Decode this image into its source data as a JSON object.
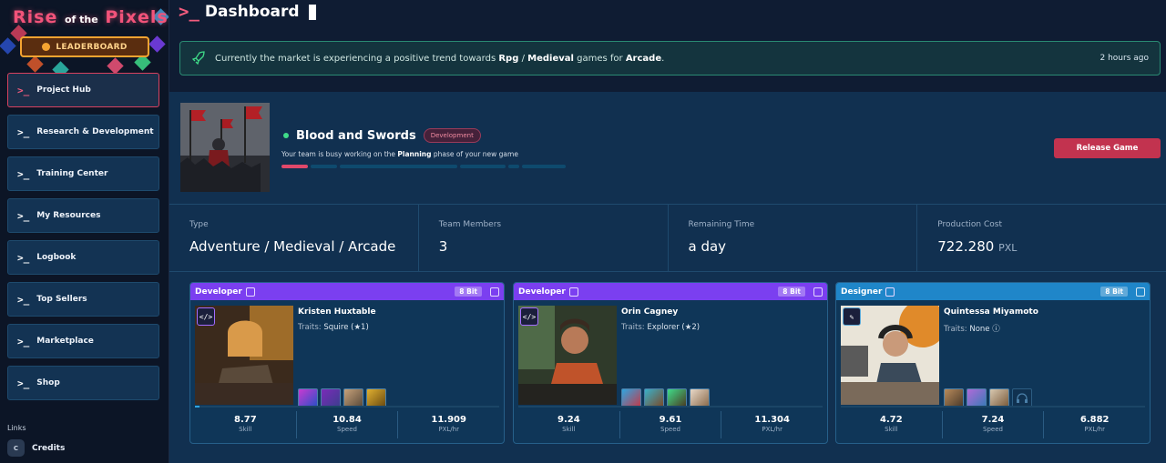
{
  "brand": {
    "title_a": "Rise",
    "title_b": "of the",
    "title_c": "Pixels",
    "leaderboard_label": "LEADERBOARD"
  },
  "nav": {
    "prompt": ">_",
    "items": [
      {
        "label": "Project Hub",
        "active": true
      },
      {
        "label": "Research & Development"
      },
      {
        "label": "Training Center"
      },
      {
        "label": "My Resources"
      },
      {
        "label": "Logbook"
      },
      {
        "label": "Top Sellers"
      },
      {
        "label": "Marketplace"
      },
      {
        "label": "Shop"
      }
    ],
    "links_heading": "Links",
    "credits_key": "C",
    "credits_label": "Credits"
  },
  "header": {
    "prompt": ">_",
    "title": "Dashboard"
  },
  "notice": {
    "text_1": "Currently the market is experiencing a positive trend towards",
    "genre_1": "Rpg",
    "sep": "/",
    "genre_2": "Medieval",
    "text_2": "games for",
    "platform": "Arcade",
    "dot": ".",
    "time": "2 hours ago"
  },
  "game": {
    "name": "Blood and Swords",
    "status": "Development",
    "sub_1": "Your team is busy working on the",
    "phase": "Planning",
    "sub_2": "phase of your new game",
    "release_label": "Release Game",
    "progress_segments": 6,
    "progress_done": 1
  },
  "stats": [
    {
      "label": "Type",
      "value": "Adventure / Medieval / Arcade",
      "unit": ""
    },
    {
      "label": "Team Members",
      "value": "3",
      "unit": ""
    },
    {
      "label": "Remaining Time",
      "value": "a day",
      "unit": ""
    },
    {
      "label": "Production Cost",
      "value": "722.280",
      "unit": "PXL"
    }
  ],
  "colors": {
    "developer": "#7b3ff0",
    "designer": "#1f86c9",
    "accent": "#f25c7d",
    "notice_border": "#2a8a72"
  },
  "members": [
    {
      "role": "Developer",
      "tier": "8 Bit",
      "badge": "</>",
      "name": "Kristen Huxtable",
      "traits_label": "Traits:",
      "traits": "Squire (★1)",
      "skill": "8.77",
      "speed": "10.84",
      "pxl": "11.909",
      "skill_label": "Skill",
      "speed_label": "Speed",
      "pxl_label": "PXL/hr",
      "progress": 0.015
    },
    {
      "role": "Developer",
      "tier": "8 Bit",
      "badge": "</>",
      "name": "Orin Cagney",
      "traits_label": "Traits:",
      "traits": "Explorer (★2)",
      "skill": "9.24",
      "speed": "9.61",
      "pxl": "11.304",
      "skill_label": "Skill",
      "speed_label": "Speed",
      "pxl_label": "PXL/hr",
      "progress": 0
    },
    {
      "role": "Designer",
      "tier": "8 Bit",
      "badge": "✎",
      "name": "Quintessa Miyamoto",
      "traits_label": "Traits:",
      "traits": "None ⓘ",
      "skill": "4.72",
      "speed": "7.24",
      "pxl": "6.882",
      "skill_label": "Skill",
      "speed_label": "Speed",
      "pxl_label": "PXL/hr",
      "progress": 0
    }
  ]
}
